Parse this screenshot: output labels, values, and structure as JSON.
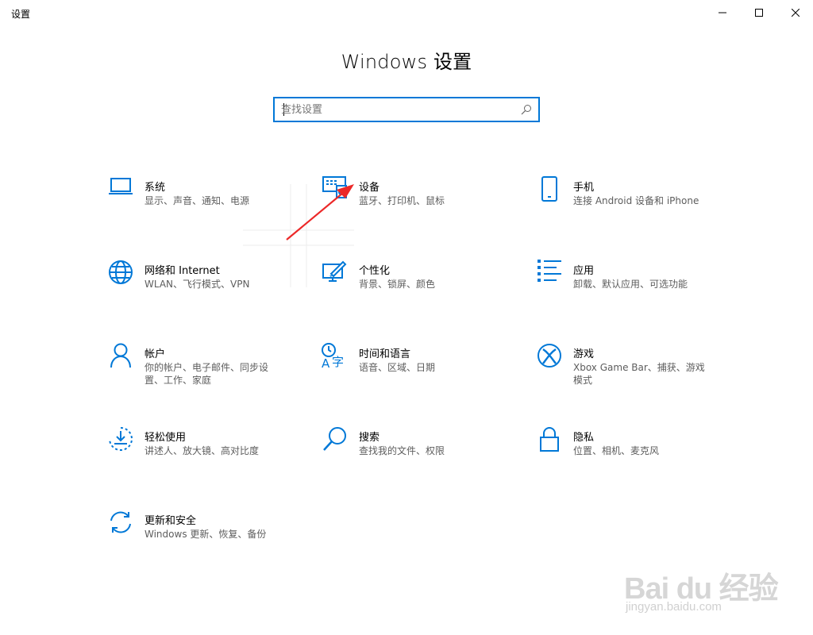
{
  "window": {
    "title": "设置",
    "controls": {
      "minimize": "minimize-icon",
      "maximize": "maximize-icon",
      "close": "close-icon"
    }
  },
  "header": {
    "title": "Windows 设置"
  },
  "search": {
    "placeholder": "查找设置",
    "value": ""
  },
  "accent_color": "#0078d7",
  "tiles": [
    {
      "icon": "laptop-icon",
      "label": "系统",
      "desc": "显示、声音、通知、电源"
    },
    {
      "icon": "devices-icon",
      "label": "设备",
      "desc": "蓝牙、打印机、鼠标"
    },
    {
      "icon": "phone-icon",
      "label": "手机",
      "desc": "连接 Android 设备和 iPhone"
    },
    {
      "icon": "globe-icon",
      "label": "网络和 Internet",
      "desc": "WLAN、飞行模式、VPN"
    },
    {
      "icon": "personalization-icon",
      "label": "个性化",
      "desc": "背景、锁屏、颜色"
    },
    {
      "icon": "apps-list-icon",
      "label": "应用",
      "desc": "卸载、默认应用、可选功能"
    },
    {
      "icon": "person-icon",
      "label": "帐户",
      "desc": "你的帐户、电子邮件、同步设置、工作、家庭"
    },
    {
      "icon": "time-language-icon",
      "label": "时间和语言",
      "desc": "语音、区域、日期"
    },
    {
      "icon": "xbox-icon",
      "label": "游戏",
      "desc": "Xbox Game Bar、捕获、游戏模式"
    },
    {
      "icon": "ease-of-access-icon",
      "label": "轻松使用",
      "desc": "讲述人、放大镜、高对比度"
    },
    {
      "icon": "search-icon",
      "label": "搜索",
      "desc": "查找我的文件、权限"
    },
    {
      "icon": "lock-icon",
      "label": "隐私",
      "desc": "位置、相机、麦克风"
    },
    {
      "icon": "update-icon",
      "label": "更新和安全",
      "desc": "Windows 更新、恢复、备份"
    }
  ],
  "watermark": {
    "logo": "Bai du 经验",
    "url": "jingyan.baidu.com"
  }
}
